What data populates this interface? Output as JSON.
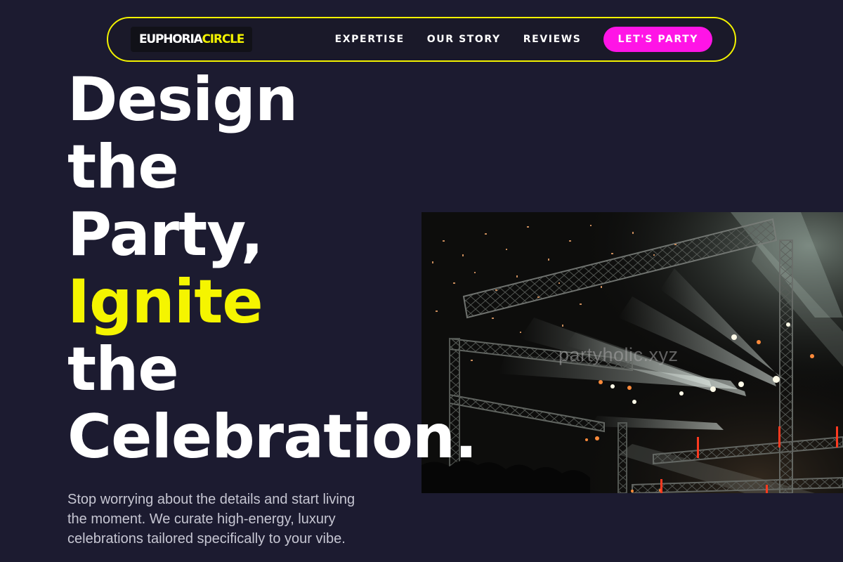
{
  "brand": {
    "name_part1": "EUPHORIA",
    "name_part2": "CIRCLE"
  },
  "nav": {
    "links": [
      "EXPERTISE",
      "OUR STORY",
      "REVIEWS"
    ],
    "cta_label": "LET'S PARTY"
  },
  "hero": {
    "title_lines": [
      "Design",
      "the",
      "Party,",
      "Ignite",
      "the",
      "Celebration."
    ],
    "highlight_line_index": 3,
    "description": "Stop worrying about the details and start living the moment. We curate high-energy, luxury celebrations tailored specifically to your vibe."
  },
  "image": {
    "watermark": "partyholic.xyz"
  },
  "colors": {
    "background": "#1c1b30",
    "accent_yellow": "#f2f200",
    "cta_magenta": "#ff14e6",
    "text_white": "#ffffff",
    "text_muted": "#c6c6d2"
  }
}
